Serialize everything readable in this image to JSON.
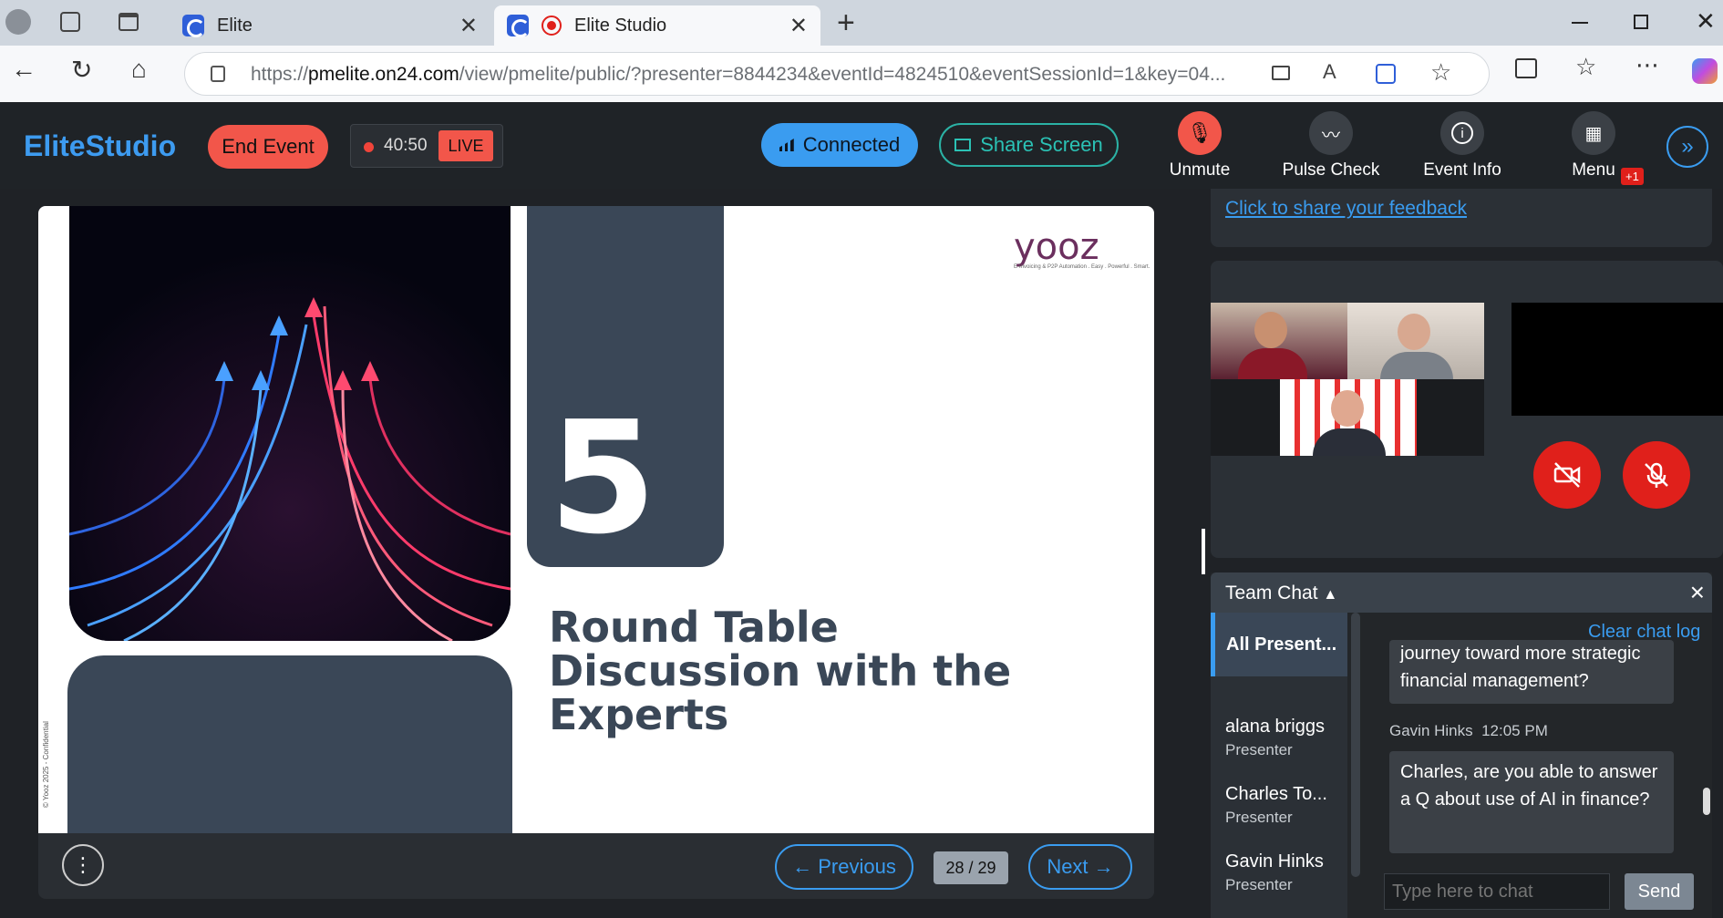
{
  "browser": {
    "tabs": [
      {
        "label": "Elite"
      },
      {
        "label": "Elite Studio"
      }
    ],
    "url_prefix": "https://",
    "url_domain": "pmelite.on24.com",
    "url_rest": "/view/pmelite/public/?presenter=8844234&eventId=4824510&eventSessionId=1&key=04..."
  },
  "header": {
    "logo_bold": "Elite",
    "logo_rest": "Studio",
    "end_event": "End Event",
    "timer": "40:50",
    "live": "LIVE",
    "connected": "Connected",
    "share_screen": "Share Screen",
    "unmute": "Unmute",
    "pulse_check": "Pulse Check",
    "event_info": "Event Info",
    "menu": "Menu",
    "menu_badge": "+1"
  },
  "slide": {
    "number": "5",
    "title": "Round Table Discussion with the Experts",
    "brand": "yooz",
    "brand_tagline": "E-Invoicing & P2P Automation . Easy . Powerful . Smart.",
    "confidential": "© Yooz 2025 - Confidential",
    "previous": "← Previous",
    "next": "Next →",
    "page_indicator": "28 / 29"
  },
  "feedback": {
    "link": "Click to share your feedback"
  },
  "chat": {
    "title": "Team Chat",
    "clear_log": "Clear chat log",
    "all_presenters": "All Present...",
    "members": [
      {
        "name": "alana briggs",
        "role": "Presenter"
      },
      {
        "name": "Charles To...",
        "role": "Presenter"
      },
      {
        "name": "Gavin Hinks",
        "role": "Presenter"
      }
    ],
    "messages": [
      {
        "text": "journey toward more strategic financial management?"
      },
      {
        "author": "Gavin Hinks",
        "time": "12:05 PM",
        "text": "Charles, are you able to answer a Q about use of AI in finance?"
      }
    ],
    "input_placeholder": "Type here to chat",
    "send": "Send"
  },
  "colors": {
    "accent": "#3a9cf0",
    "danger": "#f2564a",
    "slide_dark": "#3a4757"
  }
}
